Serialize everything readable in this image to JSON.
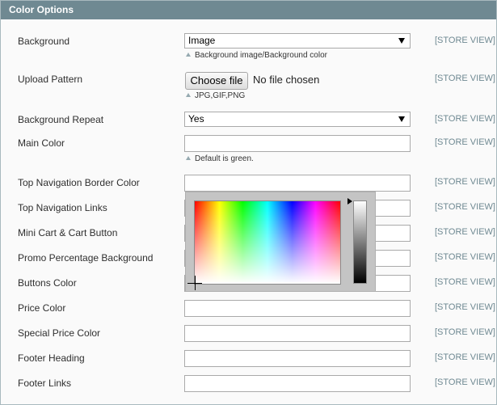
{
  "panel": {
    "title": "Color Options"
  },
  "scope_label": "[STORE VIEW]",
  "fields": {
    "background": {
      "label": "Background",
      "value": "Image",
      "note": "Background image/Background color"
    },
    "upload_pattern": {
      "label": "Upload Pattern",
      "button": "Choose file",
      "status": "No file chosen",
      "note": "JPG,GIF,PNG"
    },
    "background_repeat": {
      "label": "Background Repeat",
      "value": "Yes"
    },
    "main_color": {
      "label": "Main Color",
      "value": "",
      "note": "Default is green."
    },
    "top_nav_border": {
      "label": "Top Navigation Border Color",
      "value": ""
    },
    "top_nav_links": {
      "label": "Top Navigation Links",
      "value": ""
    },
    "mini_cart": {
      "label": "Mini Cart & Cart Button",
      "value": ""
    },
    "promo_bg": {
      "label": "Promo Percentage Background",
      "value": ""
    },
    "buttons_color": {
      "label": "Buttons Color",
      "value": ""
    },
    "price_color": {
      "label": "Price Color",
      "value": ""
    },
    "special_price": {
      "label": "Special Price Color",
      "value": ""
    },
    "footer_heading": {
      "label": "Footer Heading",
      "value": ""
    },
    "footer_links": {
      "label": "Footer Links",
      "value": ""
    }
  },
  "colors": {
    "header_bg": "#6f8992",
    "scope_text": "#6f8992",
    "note_marker": "#95a9b0"
  },
  "icons": {
    "dropdown": "caret-down-icon",
    "note": "triangle-up-icon"
  }
}
